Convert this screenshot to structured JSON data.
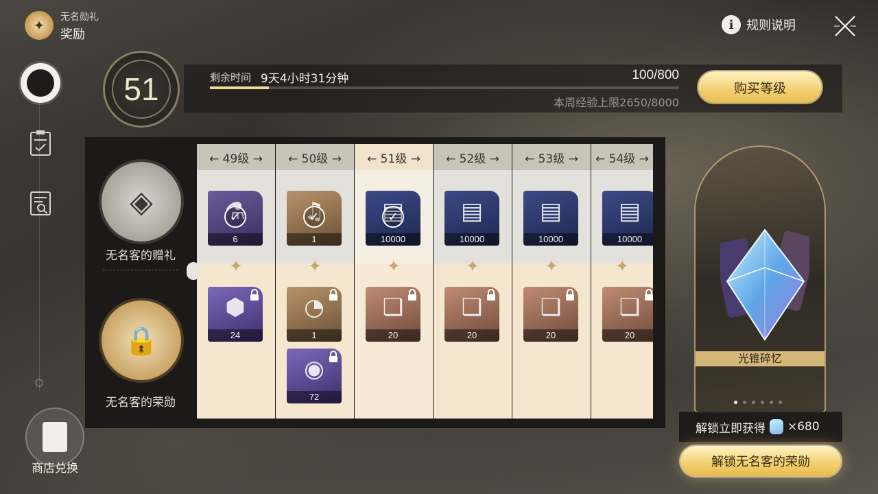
{
  "header": {
    "subtitle": "无名勋礼",
    "title": "奖励",
    "rules_label": "规则说明"
  },
  "nav": {
    "shop_label": "商店兑换"
  },
  "level_bar": {
    "level": "51",
    "time_label": "剩余时间",
    "time_value": "9天4小时31分钟",
    "exp_value": "100/800",
    "exp_progress": 0.125,
    "weekly_cap": "本周经验上限2650/8000",
    "buy_label": "购买等级"
  },
  "tracks": {
    "free_name": "无名客的赠礼",
    "paid_name": "无名客的荣勋"
  },
  "columns": [
    {
      "level": "49级",
      "free": {
        "count": "6",
        "claimed": true,
        "bg": "purple",
        "icon": "bottle-icon"
      },
      "paid": [
        {
          "count": "24",
          "locked": true,
          "bg": "violet",
          "icon": "material-icon"
        }
      ]
    },
    {
      "level": "50级",
      "free": {
        "count": "1",
        "claimed": true,
        "bg": "gold",
        "icon": "horn-icon"
      },
      "paid": [
        {
          "count": "1",
          "locked": true,
          "bg": "gold",
          "icon": "compass-icon"
        },
        {
          "count": "72",
          "locked": true,
          "bg": "violet",
          "icon": "potion-icon"
        }
      ]
    },
    {
      "level": "51级",
      "current": true,
      "free": {
        "count": "10000",
        "claimed": true,
        "bg": "navy",
        "icon": "credit-icon"
      },
      "paid": [
        {
          "count": "20",
          "locked": true,
          "bg": "rose",
          "icon": "book-icon"
        }
      ]
    },
    {
      "level": "52级",
      "free": {
        "count": "10000",
        "claimed": false,
        "bg": "navy",
        "icon": "credit-icon"
      },
      "paid": [
        {
          "count": "20",
          "locked": true,
          "bg": "rose",
          "icon": "book-icon"
        }
      ]
    },
    {
      "level": "53级",
      "free": {
        "count": "10000",
        "claimed": false,
        "bg": "navy",
        "icon": "credit-icon"
      },
      "paid": [
        {
          "count": "20",
          "locked": true,
          "bg": "rose",
          "icon": "book-icon"
        }
      ]
    },
    {
      "level": "54级",
      "free": {
        "count": "10000",
        "claimed": false,
        "bg": "navy",
        "icon": "credit-icon"
      },
      "paid": [
        {
          "count": "20",
          "locked": true,
          "bg": "rose",
          "icon": "book-icon"
        }
      ]
    }
  ],
  "showcase": {
    "label": "光锥碎忆",
    "page_index": 0,
    "page_count": 6
  },
  "unlock": {
    "tip_text": "解锁立即获得",
    "tip_amount": "×680",
    "button_label": "解锁无名客的荣勋"
  },
  "colors": {
    "accent_gold": "#f2d072",
    "panel_dark": "#1b1a18",
    "progress_fill": "#f0d99a"
  }
}
